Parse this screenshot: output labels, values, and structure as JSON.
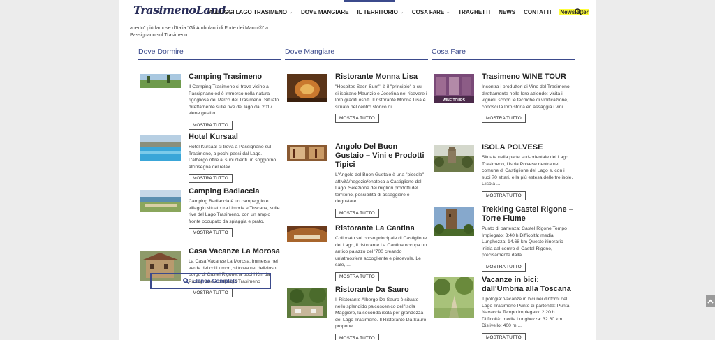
{
  "header": {
    "logo": "TrasimenoLand",
    "nav": [
      {
        "label": "ALLOGGI LAGO TRASIMENO",
        "dropdown": true
      },
      {
        "label": "DOVE MANGIARE",
        "dropdown": false
      },
      {
        "label": "IL TERRITORIO",
        "dropdown": true
      },
      {
        "label": "COSA FARE",
        "dropdown": true
      },
      {
        "label": "TRAGHETTI",
        "dropdown": false
      },
      {
        "label": "NEWS",
        "dropdown": false
      },
      {
        "label": "CONTATTI",
        "dropdown": false
      }
    ],
    "newsletter": "Newsletter",
    "search_icon": "search-icon"
  },
  "intro_text": "aperto\" più famose d'Italia \"Gli Ambulanti di Forte dei Marmi®\" a Passignano sul Trasimeno ...",
  "more_label": "MOSTRA TUTTO",
  "columns": [
    {
      "title": "Dove Dormire",
      "items": [
        {
          "title": "Camping Trasimeno",
          "text": "Il Camping Trasimeno si trova vicino a Passignano ed è immerso nella natura rigogliosa del Parco del Trasimeno. Situato direttamente sulle rive del lago dal 2017 viene gestito ..."
        },
        {
          "title": "Hotel Kursaal",
          "text": "Hotel Kursaal si trova a Passignano sul Trasimeno, a pochi passi dal Lago. L'albergo offre ai suoi clienti un soggiorno all'insegna del relax."
        },
        {
          "title": "Camping Badiaccia",
          "text": "Camping Badiaccia è un campeggio e villaggio situato tra Umbria e Toscana, sulle rive del Lago Trasimeno, con un ampio fronte occupato da spiaggia e prato."
        },
        {
          "title": "Casa Vacanze La Morosa",
          "text": "La Casa Vacanze La Morosa, immersa nel verde dei colli umbri, si trova nel delizioso borgo di Castel Rigone, a pochi Km da Passignano e dal Lago Trasimeno"
        }
      ],
      "list_button": "Elenco Completo"
    },
    {
      "title": "Dove Mangiare",
      "items": [
        {
          "title": "Ristorante Monna Lisa",
          "text": "\"Hospites Sacri Sunt\": è il \"principio\" a cui si ispirano Maurizio e Josefina nel ricevere i loro graditi ospiti. Il ristorante Monna Lisa è situato nel centro storico di ..."
        },
        {
          "title": "Angolo Del Buon Gustaio – Vini e Prodotti Tipici",
          "text": "L'Angolo del Buon Gustaio è una \"piccola\" attività/negozio/enoteca a Castiglione del Lago. Selezione dei migliori prodotti del territorio, possibilità di assaggiare e degustare ..."
        },
        {
          "title": "Ristorante La Cantina",
          "text": "Collocato sul corso principale di Castiglione del Lago, il ristorante La Cantina occupa un antico palazzo del '700 creando un'atmosfera accogliente e piacevole. Le sale, ..."
        },
        {
          "title": "Ristorante Da Sauro",
          "text": "Il Ristorante Albergo Da Sauro è situato nello splendido palcoscenico dell'Isola Maggiore, la seconda isola per grandezza del Lago Trasimeno. Il Ristorante Da Sauro propone ..."
        }
      ]
    },
    {
      "title": "Cosa Fare",
      "items": [
        {
          "title": "Trasimeno WINE TOUR",
          "text": "Incontra i produttori di Vino del Trasimeno direttamente nelle loro aziende: visita i vigneti, scopri le tecniche di vinificazione, conosci la loro storia ed assaggia i vini ...",
          "thumb_caption": "WINE TOURS"
        },
        {
          "title": "ISOLA POLVESE",
          "text": "Situata nella parte sud-orientale del Lago Trasimeno, l'Isola Polvese rientra nel comune di Castiglione del Lago e, con i suoi 70 ettari, è la più estesa delle tre isole.  L'isola ..."
        },
        {
          "title": "Trekking Castel Rigone – Torre Fiume",
          "text": "Punto di partenza: Castel Rigone Tempo Impiegato: 3:40 h Difficoltà: media Lunghezza: 14.68 km Questo itinerario inizia dal centro di Castel Rigone, precisamente dalla ..."
        },
        {
          "title": "Vacanze in bici: dall'Umbria alla Toscana",
          "text": "Tipologia: Vacanze in bici nei dintorni del Lago Trasimeno Punto di partenza: Punta Navaccia Tempo Impiegato: 2:20 h Difficoltà: media Lunghezza: 32.60 km Dislivello: 400 m ..."
        }
      ]
    }
  ],
  "colors": {
    "accent": "#3b4a8c",
    "newsletter_bg": "#ffff3c"
  }
}
